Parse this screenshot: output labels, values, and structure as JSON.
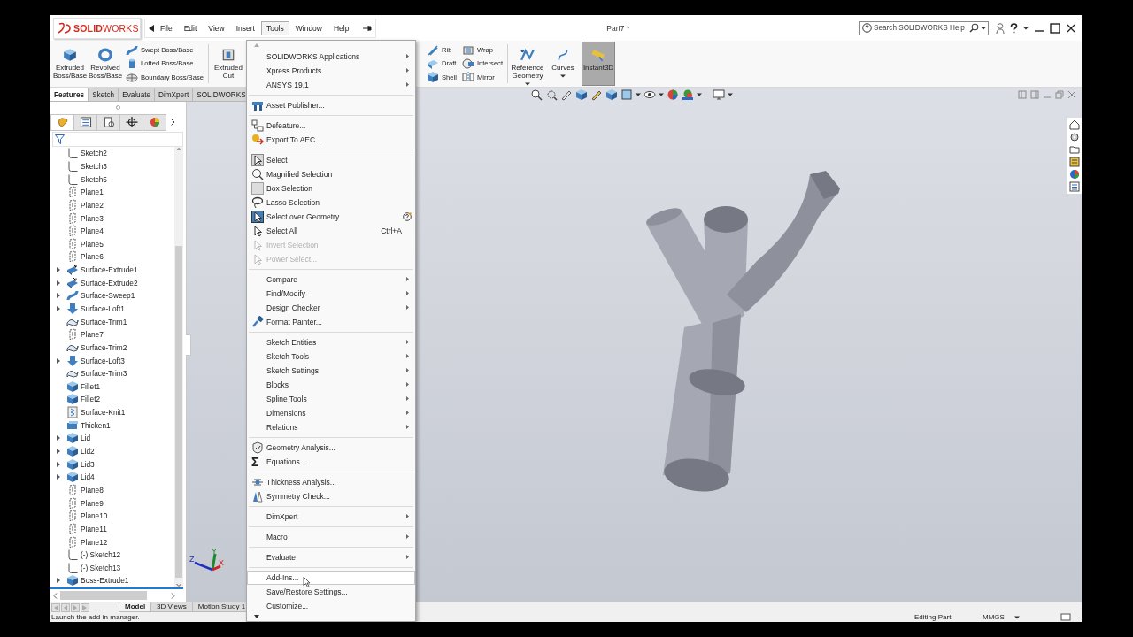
{
  "window": {
    "logo": "**SOLID**WORKS",
    "title": "Part7 *"
  },
  "menu_bar": [
    {
      "label": "File",
      "selected": false
    },
    {
      "label": "Edit",
      "selected": false
    },
    {
      "label": "View",
      "selected": false
    },
    {
      "label": "Insert",
      "selected": false
    },
    {
      "label": "Tools",
      "selected": true
    },
    {
      "label": "Window",
      "selected": false
    },
    {
      "label": "Help",
      "selected": false
    }
  ],
  "search": {
    "placeholder": "Search SOLIDWORKS Help"
  },
  "commands": {
    "left": [
      {
        "kind": "large",
        "label": "Extruded Boss/Base",
        "selected": false,
        "dropdown": false
      },
      {
        "kind": "large",
        "label": "Revolved Boss/Base",
        "selected": false,
        "dropdown": false
      },
      {
        "kind": "stack",
        "items": [
          "Swept Boss/Base",
          "Lofted Boss/Base",
          "Boundary Boss/Base"
        ]
      },
      {
        "kind": "separator"
      },
      {
        "kind": "large",
        "label": "Extruded Cut",
        "selected": false,
        "dropdown": false
      }
    ],
    "right": [
      {
        "kind": "stack",
        "items": [
          "Rib",
          "Draft",
          "Shell"
        ]
      },
      {
        "kind": "stack",
        "items": [
          "Wrap",
          "Intersect",
          "Mirror"
        ]
      },
      {
        "kind": "separator"
      },
      {
        "kind": "large",
        "label": "Reference Geometry",
        "selected": false,
        "dropdown": true
      },
      {
        "kind": "large",
        "label": "Curves",
        "selected": false,
        "dropdown": true
      },
      {
        "kind": "large",
        "label": "Instant3D",
        "selected": true,
        "dropdown": false
      }
    ]
  },
  "feature_tabs": [
    {
      "label": "Features",
      "selected": true
    },
    {
      "label": "Sketch",
      "selected": false
    },
    {
      "label": "Evaluate",
      "selected": false
    },
    {
      "label": "DimXpert",
      "selected": false
    },
    {
      "label": "SOLIDWORKS",
      "selected": false
    }
  ],
  "panel_tabs": [
    {
      "selected": true
    },
    {
      "selected": false
    },
    {
      "selected": false
    },
    {
      "selected": false
    },
    {
      "selected": false
    }
  ],
  "tree": [
    {
      "label": "Sketch2",
      "kind": "sketch"
    },
    {
      "label": "Sketch3",
      "kind": "sketch"
    },
    {
      "label": "Sketch5",
      "kind": "sketch"
    },
    {
      "label": "Plane1",
      "kind": "plane"
    },
    {
      "label": "Plane2",
      "kind": "plane"
    },
    {
      "label": "Plane3",
      "kind": "plane"
    },
    {
      "label": "Plane4",
      "kind": "plane"
    },
    {
      "label": "Plane5",
      "kind": "plane"
    },
    {
      "label": "Plane6",
      "kind": "plane"
    },
    {
      "label": "Surface-Extrude1",
      "kind": "extrude",
      "expanded": false
    },
    {
      "label": "Surface-Extrude2",
      "kind": "extrude",
      "expanded": false
    },
    {
      "label": "Surface-Sweep1",
      "kind": "sweep",
      "expanded": false
    },
    {
      "label": "Surface-Loft1",
      "kind": "loft",
      "expanded": false
    },
    {
      "label": "Surface-Trim1",
      "kind": "trim"
    },
    {
      "label": "Plane7",
      "kind": "plane"
    },
    {
      "label": "Surface-Trim2",
      "kind": "trim"
    },
    {
      "label": "Surface-Loft3",
      "kind": "loft",
      "expanded": false
    },
    {
      "label": "Surface-Trim3",
      "kind": "trim"
    },
    {
      "label": "Fillet1",
      "kind": "fillet"
    },
    {
      "label": "Fillet2",
      "kind": "fillet"
    },
    {
      "label": "Surface-Knit1",
      "kind": "knit"
    },
    {
      "label": "Thicken1",
      "kind": "thicken"
    },
    {
      "label": "Lid",
      "kind": "boss",
      "expanded": false
    },
    {
      "label": "Lid2",
      "kind": "boss",
      "expanded": false
    },
    {
      "label": "Lid3",
      "kind": "boss",
      "expanded": false
    },
    {
      "label": "Lid4",
      "kind": "boss",
      "expanded": false
    },
    {
      "label": "Plane8",
      "kind": "plane"
    },
    {
      "label": "Plane9",
      "kind": "plane"
    },
    {
      "label": "Plane10",
      "kind": "plane"
    },
    {
      "label": "Plane11",
      "kind": "plane"
    },
    {
      "label": "Plane12",
      "kind": "plane"
    },
    {
      "label": "(-) Sketch12",
      "kind": "sketch"
    },
    {
      "label": "(-) Sketch13",
      "kind": "sketch"
    },
    {
      "label": "Boss-Extrude1",
      "kind": "boss",
      "expanded": false
    }
  ],
  "triad": {
    "x": "X",
    "y": "Y",
    "z": "Z"
  },
  "tools_menu": {
    "sections": [
      [
        {
          "label": "SOLIDWORKS Applications",
          "submenu": true,
          "disabled": false,
          "selected": false
        },
        {
          "label": "Xpress Products",
          "submenu": true,
          "disabled": false,
          "selected": false
        },
        {
          "label": "ANSYS 19.1",
          "submenu": true,
          "disabled": false,
          "selected": false
        }
      ],
      [
        {
          "label": "Asset Publisher...",
          "submenu": false,
          "disabled": false,
          "selected": false
        }
      ],
      [
        {
          "label": "Defeature...",
          "submenu": false,
          "disabled": false,
          "selected": false
        },
        {
          "label": "Export To AEC...",
          "submenu": false,
          "disabled": false,
          "selected": false
        }
      ],
      [
        {
          "label": "Select",
          "submenu": false,
          "disabled": false,
          "selected": false
        },
        {
          "label": "Magnified Selection",
          "submenu": false,
          "disabled": false,
          "selected": false
        },
        {
          "label": "Box Selection",
          "submenu": false,
          "disabled": false,
          "selected": false
        },
        {
          "label": "Lasso Selection",
          "submenu": false,
          "disabled": false,
          "selected": false
        },
        {
          "label": "Select over Geometry",
          "submenu": false,
          "disabled": false,
          "selected": false,
          "help_icon": true
        },
        {
          "label": "Select All",
          "submenu": false,
          "disabled": false,
          "selected": false,
          "shortcut": "Ctrl+A"
        },
        {
          "label": "Invert Selection",
          "submenu": false,
          "disabled": true,
          "selected": false
        },
        {
          "label": "Power Select...",
          "submenu": false,
          "disabled": true,
          "selected": false
        }
      ],
      [
        {
          "label": "Compare",
          "submenu": true,
          "disabled": false,
          "selected": false
        },
        {
          "label": "Find/Modify",
          "submenu": true,
          "disabled": false,
          "selected": false
        },
        {
          "label": "Design Checker",
          "submenu": true,
          "disabled": false,
          "selected": false
        },
        {
          "label": "Format Painter...",
          "submenu": false,
          "disabled": false,
          "selected": false
        }
      ],
      [
        {
          "label": "Sketch Entities",
          "submenu": true,
          "disabled": false,
          "selected": false
        },
        {
          "label": "Sketch Tools",
          "submenu": true,
          "disabled": false,
          "selected": false
        },
        {
          "label": "Sketch Settings",
          "submenu": true,
          "disabled": false,
          "selected": false
        },
        {
          "label": "Blocks",
          "submenu": true,
          "disabled": false,
          "selected": false
        },
        {
          "label": "Spline Tools",
          "submenu": true,
          "disabled": false,
          "selected": false
        },
        {
          "label": "Dimensions",
          "submenu": true,
          "disabled": false,
          "selected": false
        },
        {
          "label": "Relations",
          "submenu": true,
          "disabled": false,
          "selected": false
        }
      ],
      [
        {
          "label": "Geometry Analysis...",
          "submenu": false,
          "disabled": false,
          "selected": false
        },
        {
          "label": "Equations...",
          "submenu": false,
          "disabled": false,
          "selected": false,
          "glyph": "Σ"
        }
      ],
      [
        {
          "label": "Thickness Analysis...",
          "submenu": false,
          "disabled": false,
          "selected": false
        },
        {
          "label": "Symmetry Check...",
          "submenu": false,
          "disabled": false,
          "selected": false
        }
      ],
      [
        {
          "label": "DimXpert",
          "submenu": true,
          "disabled": false,
          "selected": false
        }
      ],
      [
        {
          "label": "Macro",
          "submenu": true,
          "disabled": false,
          "selected": false
        }
      ],
      [
        {
          "label": "Evaluate",
          "submenu": true,
          "disabled": false,
          "selected": false
        }
      ],
      [
        {
          "label": "Add-Ins...",
          "submenu": false,
          "disabled": false,
          "selected": true
        },
        {
          "label": "Save/Restore Settings...",
          "submenu": false,
          "disabled": false,
          "selected": false
        },
        {
          "label": "Customize...",
          "submenu": false,
          "disabled": false,
          "selected": false
        }
      ]
    ]
  },
  "bottom_tabs": [
    {
      "label": "Model",
      "selected": true
    },
    {
      "label": "3D Views",
      "selected": false
    },
    {
      "label": "Motion Study 1",
      "selected": false
    }
  ],
  "status_bar": {
    "message": "Launch the add-in manager.",
    "mode": "Editing Part",
    "units": "MMGS"
  }
}
